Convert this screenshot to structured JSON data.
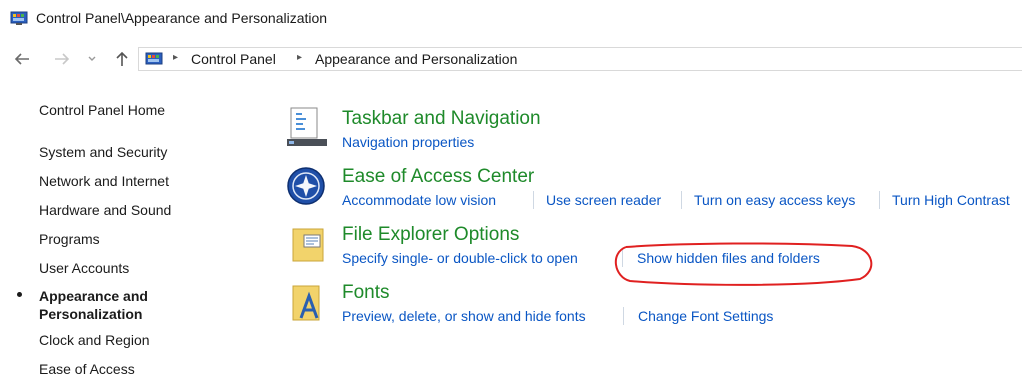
{
  "window": {
    "title": "Control Panel\\Appearance and Personalization"
  },
  "nav": {
    "back_icon": "back-arrow-icon",
    "forward_icon": "forward-arrow-icon",
    "recent_icon": "chevron-down-icon",
    "up_icon": "up-arrow-icon",
    "breadcrumbs": [
      "Control Panel",
      "Appearance and Personalization"
    ]
  },
  "sidebar": {
    "home": "Control Panel Home",
    "items": [
      "System and Security",
      "Network and Internet",
      "Hardware and Sound",
      "Programs",
      "User Accounts"
    ],
    "current": [
      "Appearance and",
      "Personalization"
    ],
    "items_after": [
      "Clock and Region",
      "Ease of Access"
    ]
  },
  "categories": [
    {
      "title": "Taskbar and Navigation",
      "icon": "taskbar-icon",
      "links": [
        "Navigation properties"
      ]
    },
    {
      "title": "Ease of Access Center",
      "icon": "ease-of-access-icon",
      "links": [
        "Accommodate low vision",
        "Use screen reader",
        "Turn on easy access keys",
        "Turn High Contrast"
      ]
    },
    {
      "title": "File Explorer Options",
      "icon": "folder-options-icon",
      "links": [
        "Specify single- or double-click to open",
        "Show hidden files and folders"
      ]
    },
    {
      "title": "Fonts",
      "icon": "fonts-icon",
      "links": [
        "Preview, delete, or show and hide fonts",
        "Change Font Settings"
      ]
    }
  ],
  "colors": {
    "category_title": "#1e8a2a",
    "link": "#0a56c4",
    "annotation": "#e02020"
  }
}
